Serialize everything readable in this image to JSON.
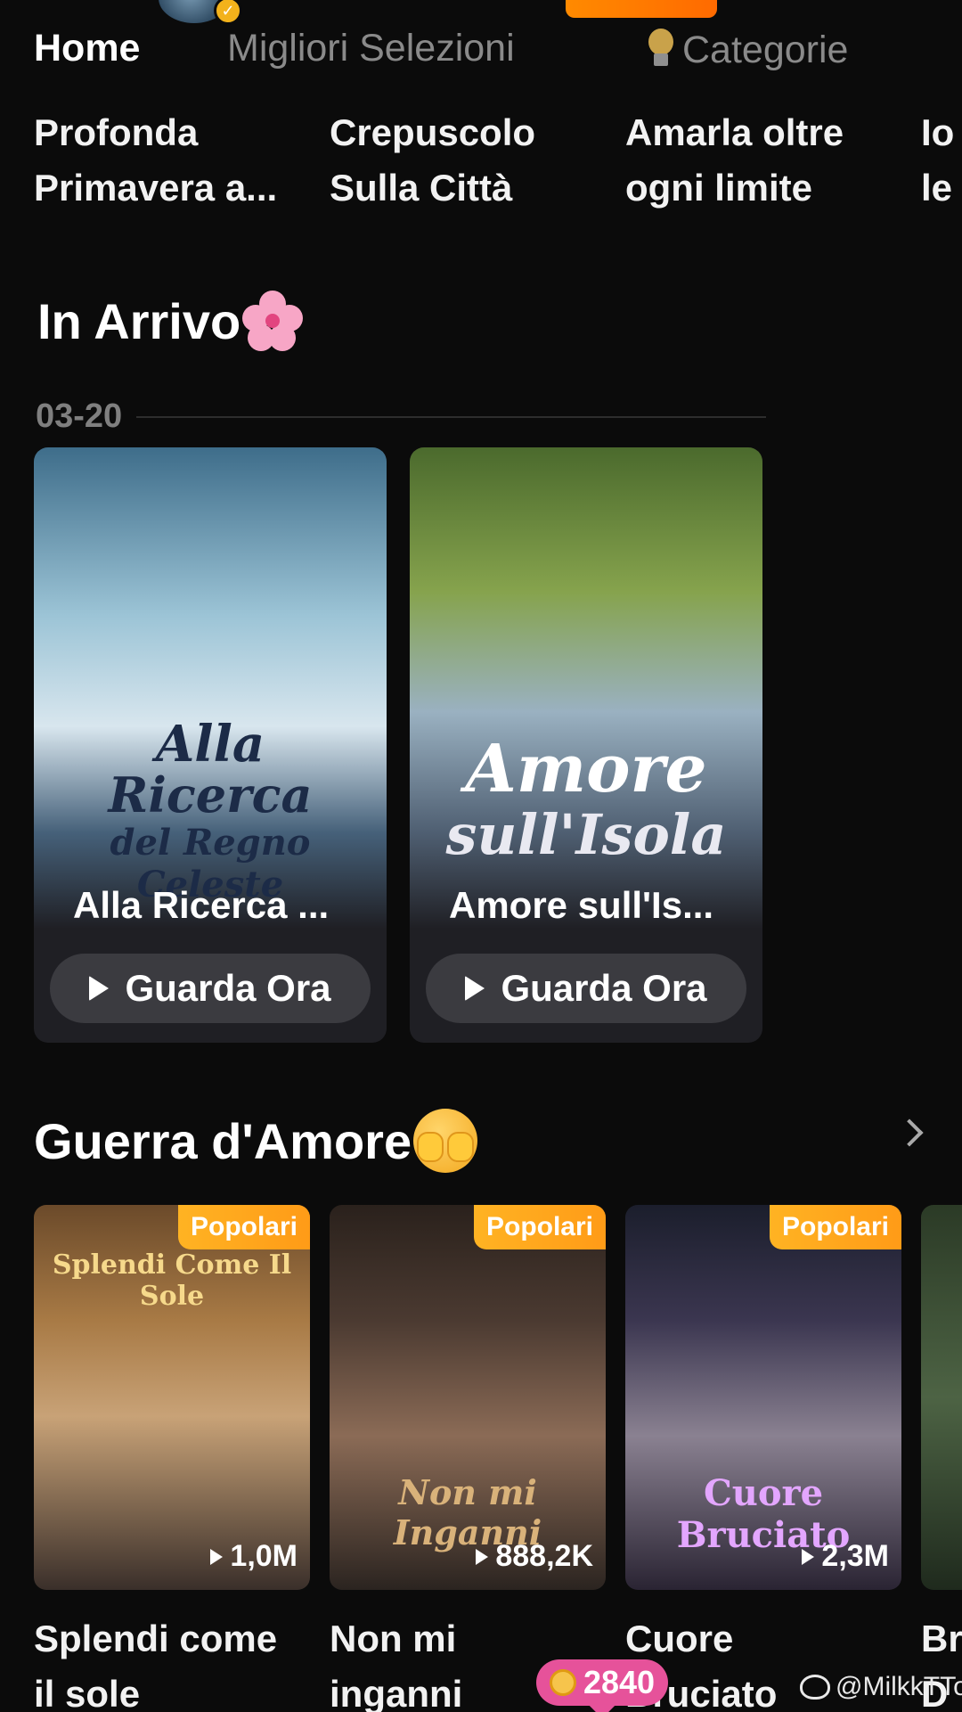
{
  "tabs": {
    "home": "Home",
    "migliori": "Migliori Selezioni",
    "categorie": "Categorie"
  },
  "title_strip": [
    {
      "line1": "Profonda",
      "line2": "Primavera a..."
    },
    {
      "line1": "Crepuscolo",
      "line2": "Sulla Città"
    },
    {
      "line1": "Amarla oltre",
      "line2": "ogni limite"
    },
    {
      "line1": "Io",
      "line2": "le"
    }
  ],
  "upcoming": {
    "title": "In Arrivo",
    "date": "03-20",
    "cards": [
      {
        "poster_line1": "Alla",
        "poster_line2": "Ricerca",
        "poster_line3": "del Regno Celeste",
        "name": "Alla Ricerca ...",
        "button": "Guarda Ora"
      },
      {
        "poster_line1": "Amore",
        "poster_line2": "sull'Isola",
        "name": "Amore sull'Is...",
        "button": "Guarda Ora"
      }
    ]
  },
  "section": {
    "title": "Guerra d'Amore",
    "dramas": [
      {
        "badge": "Popolari",
        "poster_title": "Splendi Come Il Sole",
        "views": "1,0M",
        "name_line1": "Splendi come",
        "name_line2": "il sole"
      },
      {
        "badge": "Popolari",
        "poster_title": "Non mi Inganni",
        "views": "888,2K",
        "name_line1": "Non mi",
        "name_line2": "inganni"
      },
      {
        "badge": "Popolari",
        "poster_title": "Cuore Bruciato",
        "views": "2,3M",
        "name_line1": "Cuore",
        "name_line2": "Bruciato"
      },
      {
        "name_line1": "Br",
        "name_line2": "D"
      }
    ]
  },
  "coins": "2840",
  "watermark": "@MilkkTTo",
  "colors": {
    "background": "#0b0b0b",
    "badge": "#ffb323",
    "coin_pill": "#e6529a",
    "accent_orange": "#ff8a00"
  }
}
